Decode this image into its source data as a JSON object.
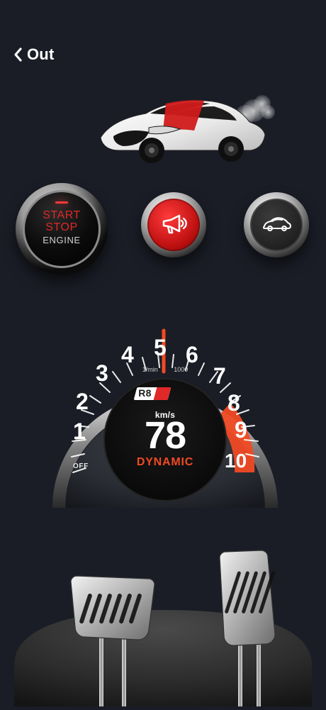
{
  "nav": {
    "back_label": "Out"
  },
  "controls": {
    "start_stop": {
      "line1": "START",
      "line2": "STOP",
      "line3": "ENGINE"
    }
  },
  "gauge": {
    "rpm_left": "1/min",
    "rpm_right": "1000",
    "off_label": "OFF",
    "logo": "R8",
    "unit": "km/s",
    "value": "78",
    "mode": "DYNAMIC",
    "dial_numbers": [
      "1",
      "2",
      "3",
      "4",
      "5",
      "6",
      "7",
      "8",
      "9",
      "10"
    ]
  },
  "colors": {
    "background": "#1a1d26",
    "accent_red": "#f04a24"
  }
}
